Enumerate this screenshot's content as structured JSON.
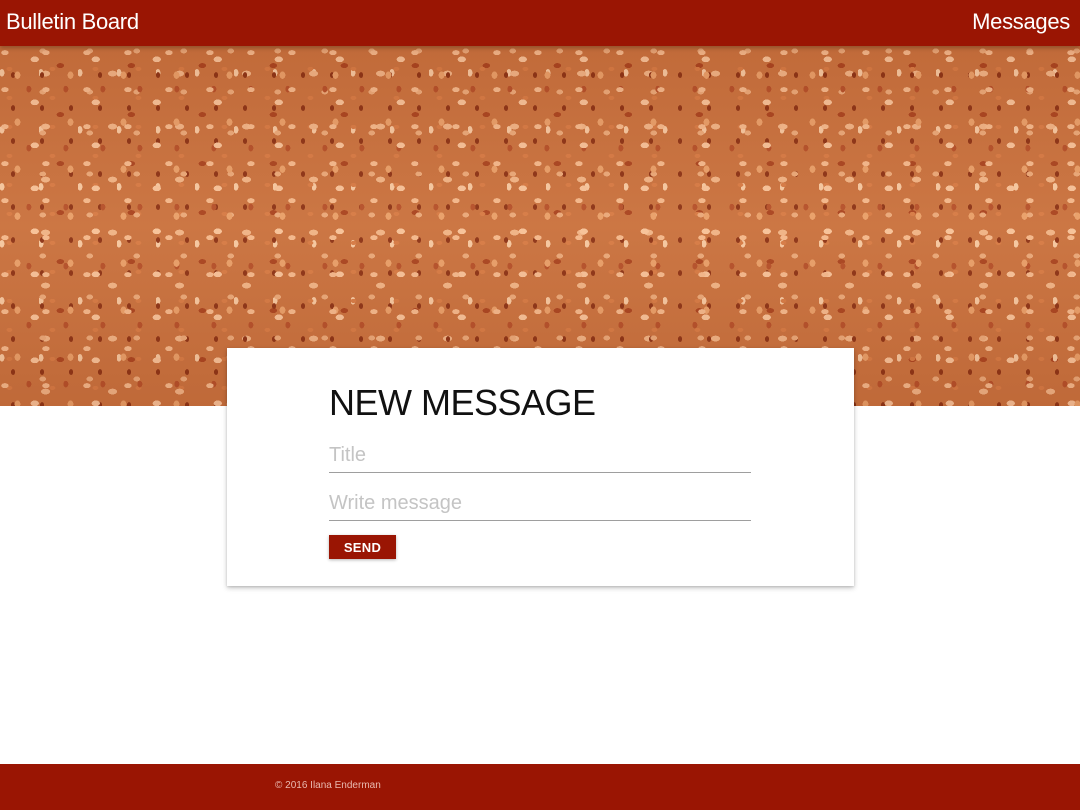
{
  "navbar": {
    "brand": "Bulletin Board",
    "messages_link": "Messages"
  },
  "banner": {
    "image_description": "cork board texture"
  },
  "new_message": {
    "heading": "NEW MESSAGE",
    "title_placeholder": "Title",
    "title_value": "",
    "message_placeholder": "Write message",
    "message_value": "",
    "send_label": "SEND"
  },
  "footer": {
    "copyright": "© 2016 Ilana Enderman"
  },
  "colors": {
    "primary": "#9a1503",
    "placeholder": "#c4c4c4"
  }
}
